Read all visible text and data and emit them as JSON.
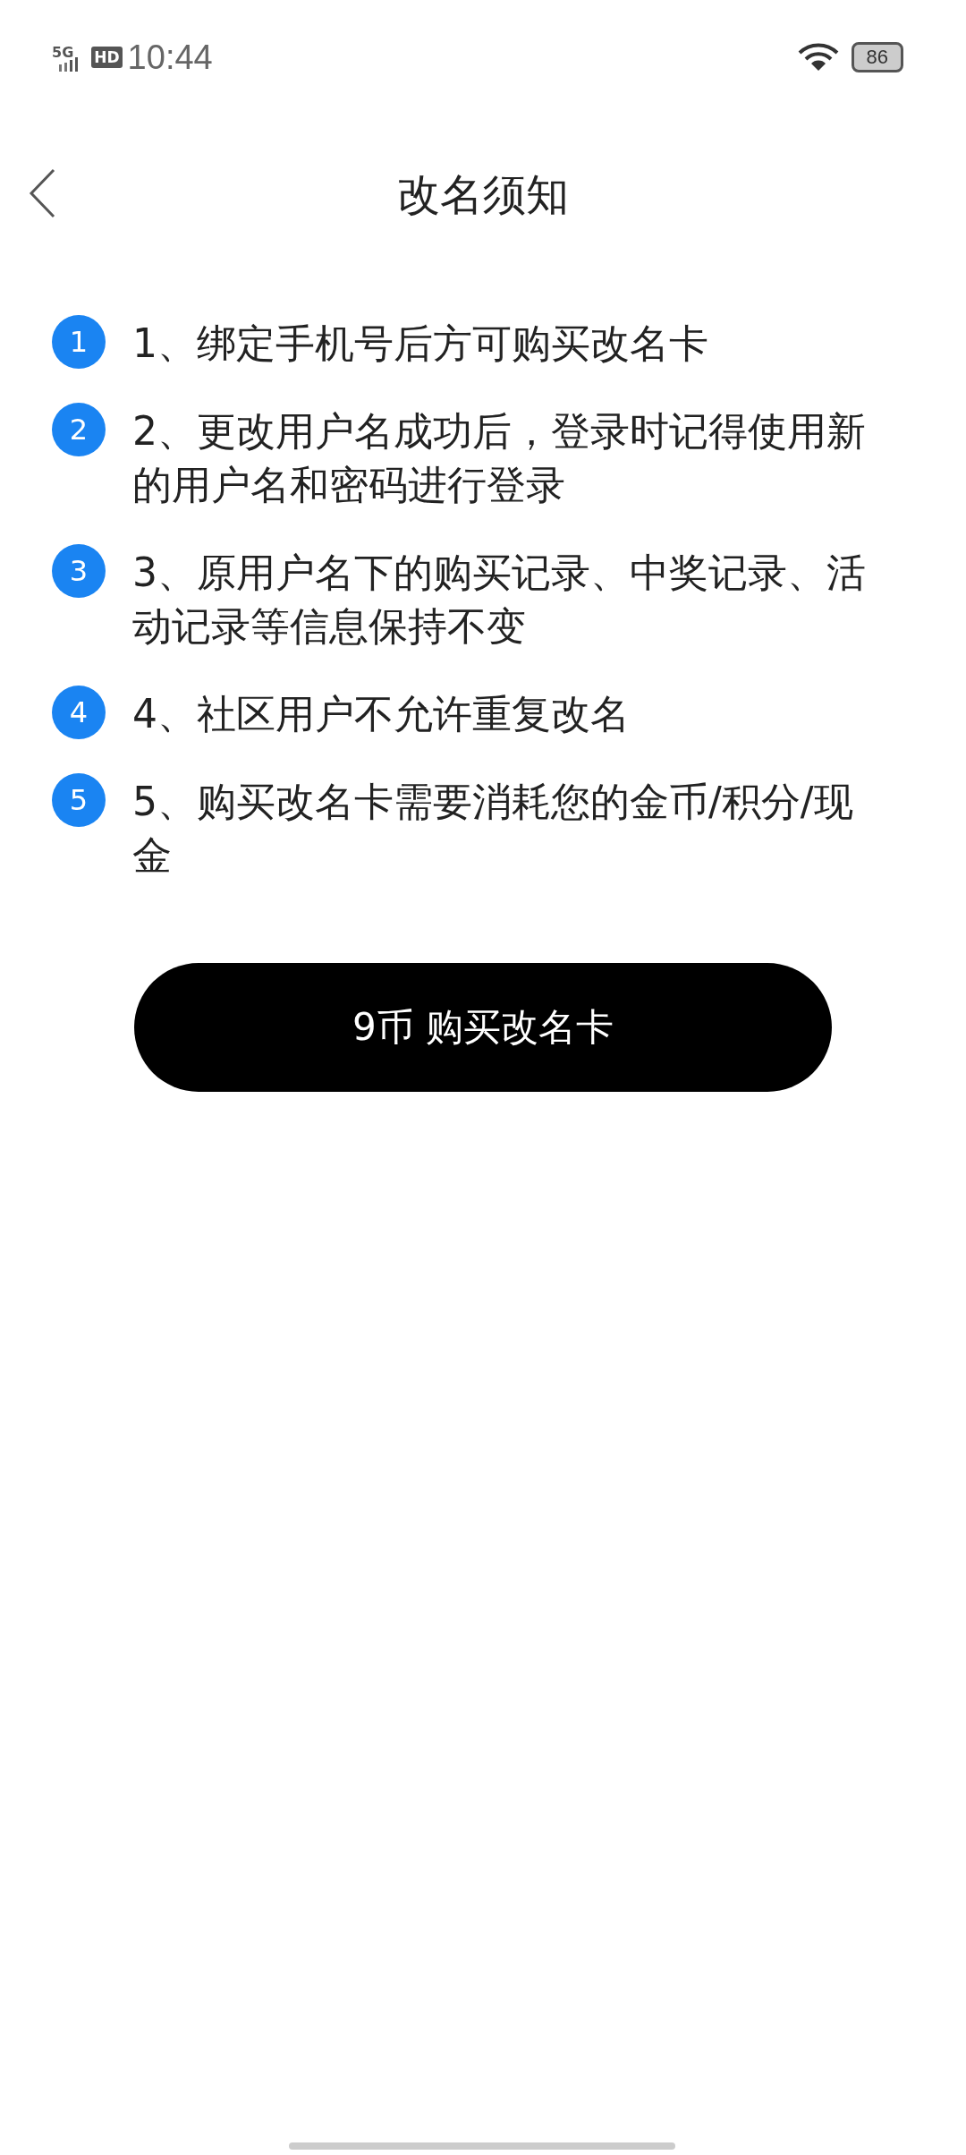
{
  "status_bar": {
    "network": "5G",
    "hd": "HD",
    "time": "10:44",
    "battery": "86"
  },
  "header": {
    "title": "改名须知"
  },
  "notices": [
    {
      "badge": "1",
      "text": "1、绑定手机号后方可购买改名卡"
    },
    {
      "badge": "2",
      "text": "2、更改用户名成功后，登录时记得使用新的用户名和密码进行登录"
    },
    {
      "badge": "3",
      "text": "3、原用户名下的购买记录、中奖记录、活动记录等信息保持不变"
    },
    {
      "badge": "4",
      "text": "4、社区用户不允许重复改名"
    },
    {
      "badge": "5",
      "text": "5、购买改名卡需要消耗您的金币/积分/现金"
    }
  ],
  "buy_button": {
    "label": "9币 购买改名卡"
  }
}
